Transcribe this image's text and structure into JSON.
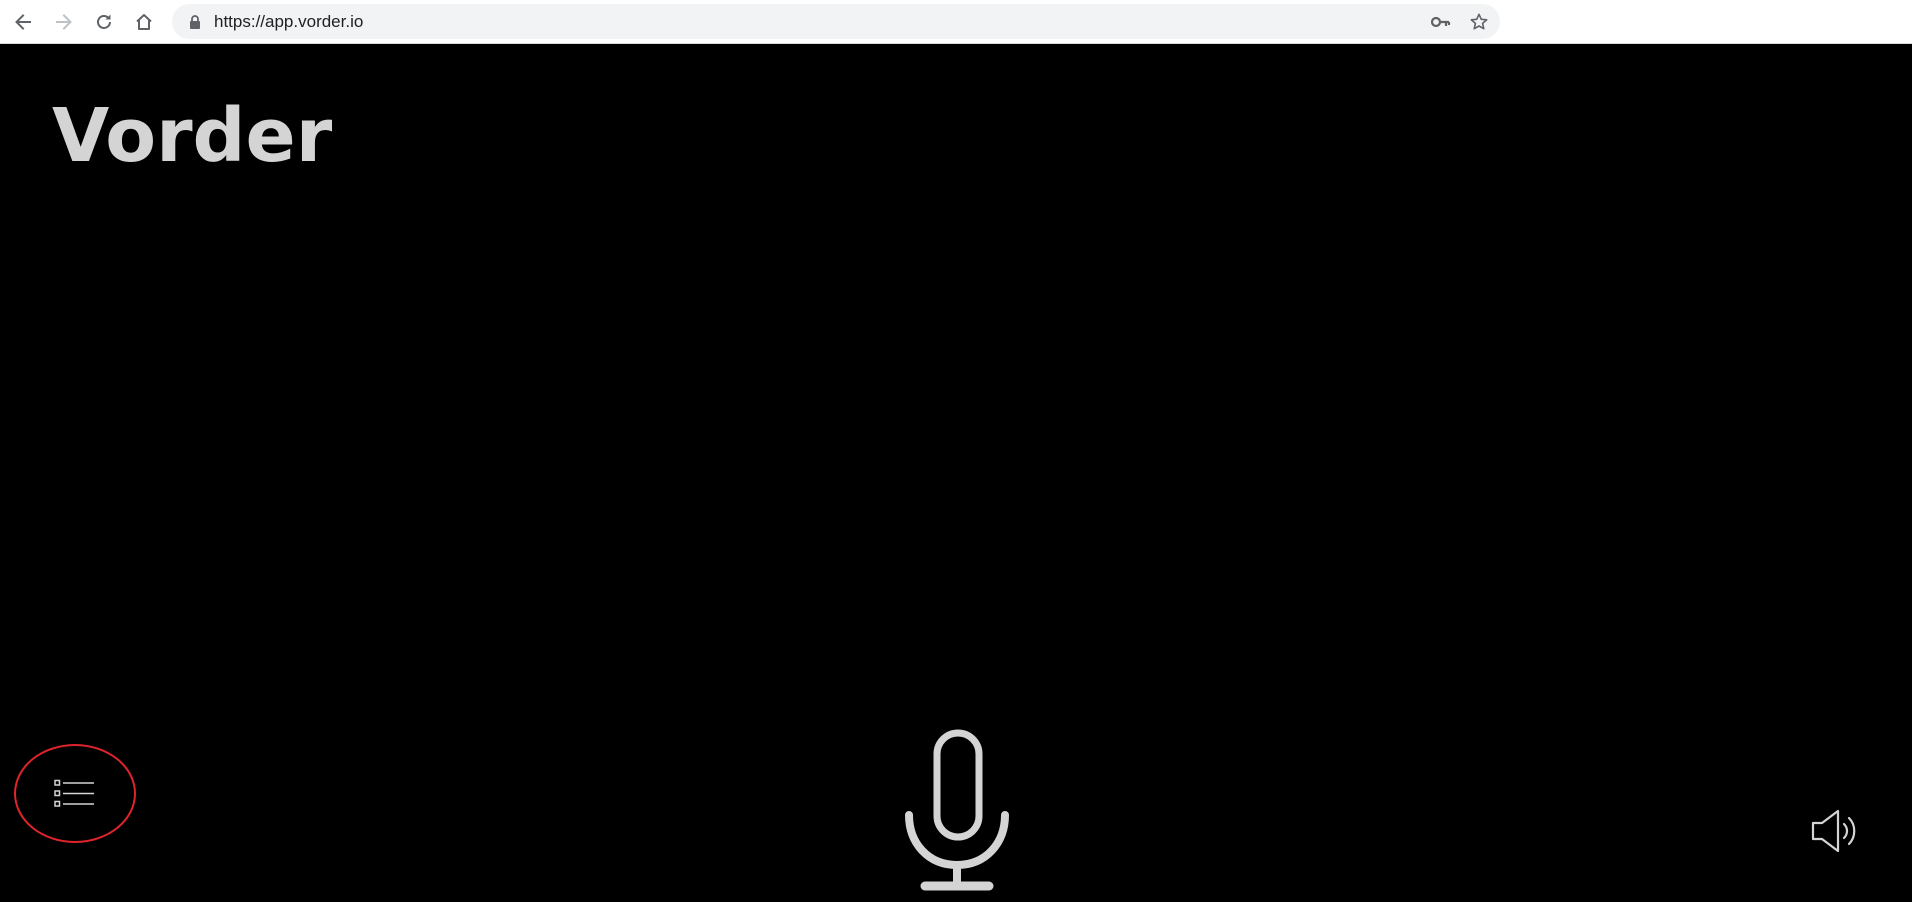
{
  "browser": {
    "url": "https://app.vorder.io",
    "icons": {
      "back": "arrow-left-icon",
      "forward": "arrow-right-icon",
      "reload": "reload-icon",
      "home": "home-icon",
      "lock": "lock-icon",
      "key": "key-icon",
      "bookmark": "star-icon"
    }
  },
  "app": {
    "title": "Vorder",
    "colors": {
      "background": "#000000",
      "foreground": "#d4d4d4",
      "highlight": "#e0242b"
    },
    "controls": {
      "menu_icon": "list-icon",
      "mic_icon": "microphone-icon",
      "speaker_icon": "speaker-icon"
    }
  }
}
